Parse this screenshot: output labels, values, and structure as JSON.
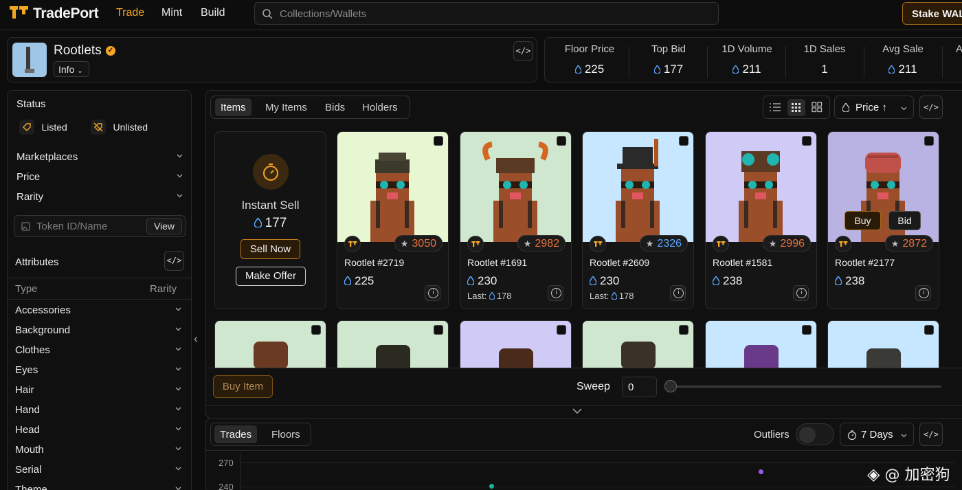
{
  "nav": {
    "brand": "TradePort",
    "links": [
      "Trade",
      "Mint",
      "Build"
    ],
    "search_placeholder": "Collections/Wallets",
    "stake_label": "Stake WAL"
  },
  "collection": {
    "name": "Rootlets",
    "info_label": "Info",
    "stats": [
      {
        "label": "Floor Price",
        "value": "225",
        "currency": true
      },
      {
        "label": "Top Bid",
        "value": "177",
        "currency": true
      },
      {
        "label": "1D Volume",
        "value": "211",
        "currency": true
      },
      {
        "label": "1D Sales",
        "value": "1",
        "currency": false
      },
      {
        "label": "Avg Sale",
        "value": "211",
        "currency": true
      },
      {
        "label": "A",
        "value": "",
        "currency": false
      }
    ]
  },
  "sidebar": {
    "status_title": "Status",
    "listed": "Listed",
    "unlisted": "Unlisted",
    "filters": [
      "Marketplaces",
      "Price",
      "Rarity"
    ],
    "token_placeholder": "Token ID/Name",
    "view_label": "View",
    "attributes_title": "Attributes",
    "type_label": "Type",
    "rarity_label": "Rarity",
    "attributes": [
      "Accessories",
      "Background",
      "Clothes",
      "Eyes",
      "Hair",
      "Hand",
      "Head",
      "Mouth",
      "Serial",
      "Theme"
    ]
  },
  "tabs": [
    "Items",
    "My Items",
    "Bids",
    "Holders"
  ],
  "sort_label": "Price ↑",
  "instant_sell": {
    "title": "Instant Sell",
    "value": "177",
    "sell_now": "Sell Now",
    "make_offer": "Make Offer"
  },
  "cards": [
    {
      "title": "Rootlet #2719",
      "rank": "3050",
      "price": "225",
      "last_label": "",
      "last": "",
      "bg": "#e6f7d2"
    },
    {
      "title": "Rootlet #1691",
      "rank": "2982",
      "price": "230",
      "last_label": "Last:",
      "last": "178",
      "bg": "#cfe6cf"
    },
    {
      "title": "Rootlet #2609",
      "rank": "2326",
      "price": "230",
      "last_label": "Last:",
      "last": "178",
      "bg": "#c6e7ff"
    },
    {
      "title": "Rootlet #1581",
      "rank": "2996",
      "price": "238",
      "last_label": "",
      "last": "",
      "bg": "#cfcaf6"
    },
    {
      "title": "Rootlet #2177",
      "rank": "2872",
      "price": "238",
      "last_label": "",
      "last": "",
      "bg": "#b9b3e3"
    }
  ],
  "card_actions": {
    "buy": "Buy",
    "bid": "Bid"
  },
  "row2_bgs": [
    "#cfe6cf",
    "#cfe6cf",
    "#cfcaf6",
    "#cfe6cf",
    "#c6e7ff",
    "#c6e7ff"
  ],
  "bottom": {
    "buy_item": "Buy Item",
    "sweep_label": "Sweep",
    "sweep_value": "0"
  },
  "chart_tabs": [
    "Trades",
    "Floors"
  ],
  "outliers_label": "Outliers",
  "days_label": "7 Days",
  "chart_axis": [
    "270",
    "240"
  ],
  "watermark": "@ 加密狗",
  "colors": {
    "accent": "#f5a623",
    "rank_orange": "#e8713a",
    "rank_blue": "#5aa6ff",
    "drop_blue": "#5aa6ff"
  }
}
